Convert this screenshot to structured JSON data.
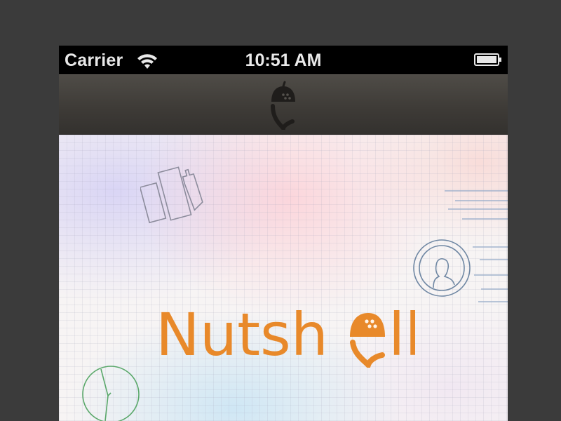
{
  "status_bar": {
    "carrier": "Carrier",
    "time": "10:51 AM",
    "wifi_icon": "wifi-icon",
    "battery_icon": "battery-icon"
  },
  "nav_bar": {
    "logo_icon": "acorn-logo-icon"
  },
  "splash": {
    "brand_name": "Nutshell",
    "brand_color": "#e8892a",
    "decorations": [
      "buildings-icon",
      "person-icon",
      "clock-icon"
    ]
  },
  "colors": {
    "status_bar_bg": "#000000",
    "nav_bar_bg": "#45423e",
    "page_bg": "#3b3b3b"
  }
}
